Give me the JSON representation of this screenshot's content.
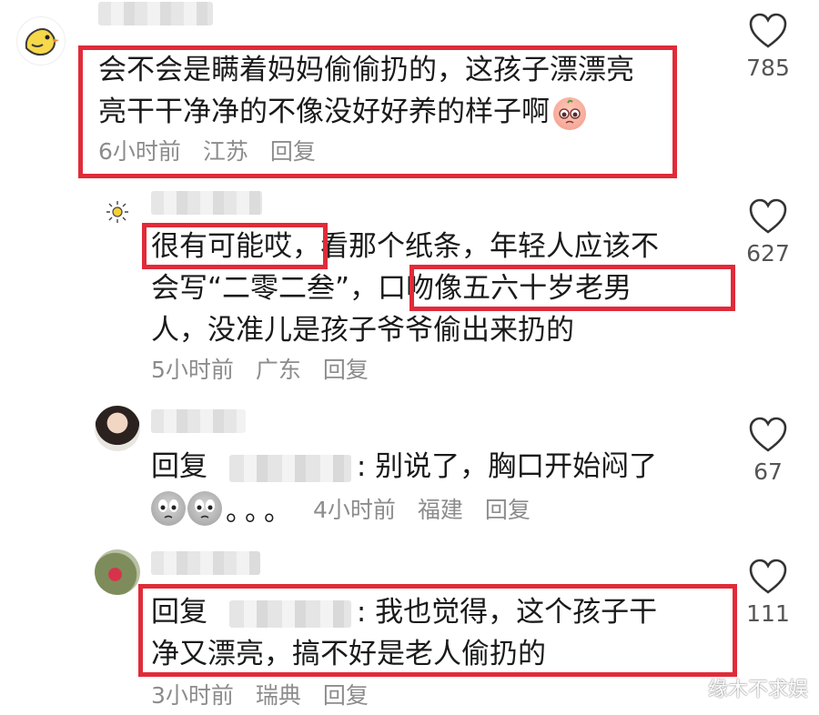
{
  "comments": [
    {
      "lines": [
        "会不会是瞒着妈妈偷偷扔的，这孩子漂漂亮",
        "亮干干净净的不像没好好养的样子啊"
      ],
      "time": "6小时前",
      "location": "江苏",
      "reply_label": "回复",
      "likes": "785",
      "avatar_icon": "chick-icon"
    },
    {
      "lines": [
        "很有可能哎，看那个纸条，年轻人应该不",
        "会写“二零二叁”，口吻像五六十岁老男",
        "人，没准儿是孩子爷爷偷出来扔的"
      ],
      "time": "5小时前",
      "location": "广东",
      "reply_label": "回复",
      "likes": "627",
      "avatar_icon": "sun-icon"
    },
    {
      "reply_prefix": "回复",
      "text": ": 别说了，胸口开始闷了",
      "suffix": "。。。",
      "time": "4小时前",
      "location": "福建",
      "reply_label": "回复",
      "likes": "67",
      "avatar_icon": "user-photo-avatar"
    },
    {
      "reply_prefix": "回复",
      "text": ": 我也觉得，这个孩子干",
      "line2": "净又漂亮，搞不好是老人偷扔的",
      "time": "3小时前",
      "location": "瑞典",
      "reply_label": "回复",
      "likes": "111",
      "avatar_icon": "flower-photo-avatar"
    }
  ],
  "watermark": "缘木不求娱",
  "colors": {
    "highlight_box": "#e02b3a",
    "meta_gray": "#8c8c8c"
  }
}
